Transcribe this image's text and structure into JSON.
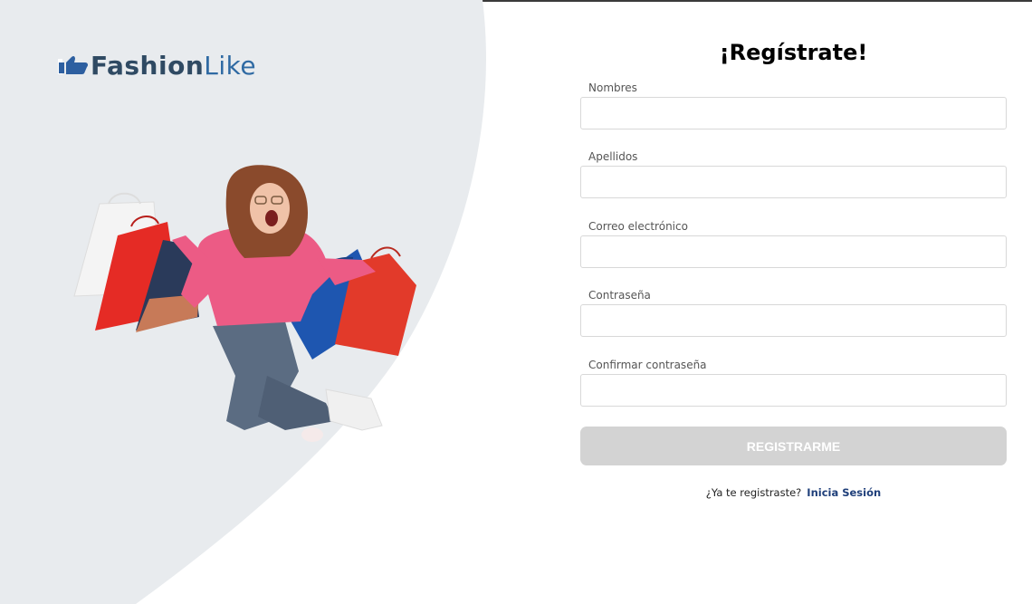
{
  "brand": {
    "name_part1": "Fashion",
    "name_part2": "Like",
    "logo_icon": "thumbs-up-icon",
    "colors": {
      "dark": "#2f4a63",
      "accent": "#2f6aa3"
    }
  },
  "hero": {
    "image": "woman-jumping-with-shopping-bags"
  },
  "form": {
    "title": "¡Regístrate!",
    "fields": [
      {
        "label": "Nombres",
        "value": "",
        "type": "text"
      },
      {
        "label": "Apellidos",
        "value": "",
        "type": "text"
      },
      {
        "label": "Correo electrónico",
        "value": "",
        "type": "email"
      },
      {
        "label": "Contraseña",
        "value": "",
        "type": "password"
      },
      {
        "label": "Confirmar contraseña",
        "value": "",
        "type": "password"
      }
    ],
    "submit_label": "REGISTRARME",
    "submit_color": "#d3d3d3",
    "login_prompt": "¿Ya te registraste?",
    "login_link": "Inicia Sesión",
    "link_color": "#1f3f7a"
  },
  "theme": {
    "panel_bg": "#e8ebee",
    "page_bg": "#ffffff"
  }
}
